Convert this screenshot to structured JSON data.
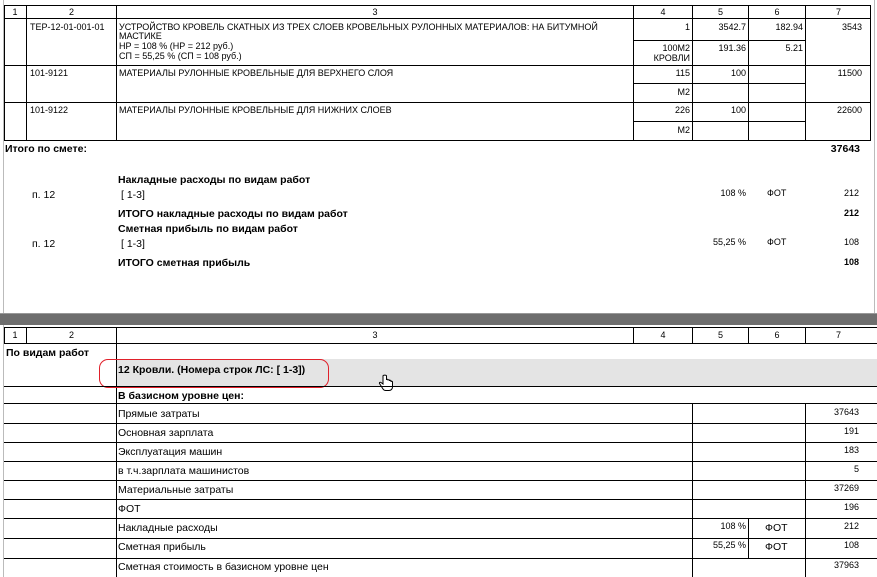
{
  "headers": [
    "1",
    "2",
    "3",
    "4",
    "5",
    "6",
    "7"
  ],
  "top": {
    "rows": [
      {
        "code": "ТЕР-12-01-001-01",
        "name_lines": [
          "УСТРОЙСТВО КРОВЕЛЬ СКАТНЫХ ИЗ ТРЕХ СЛОЕВ КРОВЕЛЬНЫХ РУЛОННЫХ МАТЕРИАЛОВ: НА БИТУМНОЙ",
          "МАСТИКЕ",
          "НР = 108 %  (НР = 212 руб.)",
          "СП = 55,25 % (СП = 108 руб.)"
        ],
        "qty": "1",
        "unit_lines": [
          "100М2",
          "КРОВЛИ"
        ],
        "price": "3542.7",
        "price_lower": "191.36",
        "coef": "182.94",
        "coef_lower": "5.21",
        "total": "3543"
      },
      {
        "code": "101-9121",
        "name_lines": [
          "МАТЕРИАЛЫ РУЛОННЫЕ КРОВЕЛЬНЫЕ ДЛЯ ВЕРХНЕГО СЛОЯ"
        ],
        "qty": "115",
        "unit_lines": [
          "М2"
        ],
        "price": "100",
        "total": "11500"
      },
      {
        "code": "101-9122",
        "name_lines": [
          "МАТЕРИАЛЫ РУЛОННЫЕ КРОВЕЛЬНЫЕ ДЛЯ НИЖНИХ СЛОЕВ"
        ],
        "qty": "226",
        "unit_lines": [
          "М2"
        ],
        "price": "100",
        "total": "22600"
      }
    ],
    "total_label": "Итого по смете:",
    "total_value": "37643",
    "overhead": {
      "title": "Накладные расходы по видам работ",
      "item": "п. 12",
      "range": "[ 1-3]",
      "percent": "108 %",
      "base": "ФОТ",
      "value": "212",
      "total_label": "ИТОГО накладные расходы по видам работ",
      "total_value": "212"
    },
    "profit": {
      "title": "Сметная прибыль по видам работ",
      "item": "п. 12",
      "range": "[ 1-3]",
      "percent": "55,25 %",
      "base": "ФОТ",
      "value": "108",
      "total_label": "ИТОГО сметная прибыль",
      "total_value": "108"
    }
  },
  "bottom": {
    "section_label": "По видам работ",
    "group_title": "12 Кровли. (Номера строк ЛС: [ 1-3])",
    "base_level_label": "В базисном уровне цен:",
    "rows": [
      {
        "label": "Прямые затраты",
        "pct": "",
        "base": "",
        "value": "37643"
      },
      {
        "label": "Основная зарплата",
        "pct": "",
        "base": "",
        "value": "191"
      },
      {
        "label": "Эксплуатация машин",
        "pct": "",
        "base": "",
        "value": "183"
      },
      {
        "label": "в т.ч.зарплата машинистов",
        "pct": "",
        "base": "",
        "value": "5"
      },
      {
        "label": "Материальные затраты",
        "pct": "",
        "base": "",
        "value": "37269"
      },
      {
        "label": "ФОТ",
        "pct": "",
        "base": "",
        "value": "196"
      },
      {
        "label": "Накладные расходы",
        "pct": "108 %",
        "base": "ФОТ",
        "value": "212"
      },
      {
        "label": "Сметная прибыль",
        "pct": "55,25 %",
        "base": "ФОТ",
        "value": "108"
      },
      {
        "label": "Сметная стоимость в базисном уровне цен",
        "pct": "",
        "base": "",
        "value": "37963"
      }
    ]
  },
  "colors": {
    "highlight_oval": "#e0202a",
    "group_band": "#e4e4e4",
    "divider": "#6e6e6e"
  },
  "icons": {
    "cursor": "hand-cursor-icon"
  }
}
